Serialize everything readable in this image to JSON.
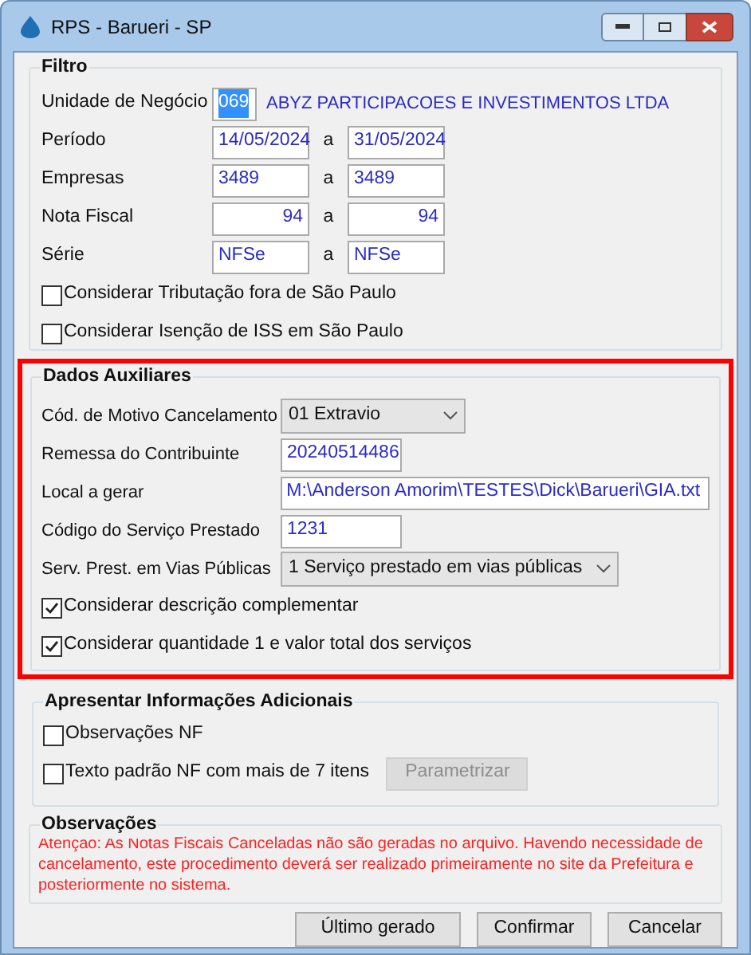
{
  "window": {
    "title": "RPS - Barueri - SP"
  },
  "filtro": {
    "title": "Filtro",
    "unidade": {
      "label": "Unidade de Negócio",
      "code": "069",
      "code_selected": true,
      "name": "ABYZ PARTICIPACOES E INVESTIMENTOS LTDA"
    },
    "ranges": [
      {
        "label": "Período",
        "from": "14/05/2024",
        "sep": "a",
        "to": "31/05/2024",
        "numeric": false
      },
      {
        "label": "Empresas",
        "from": "3489",
        "sep": "a",
        "to": "3489",
        "numeric": false
      },
      {
        "label": "Nota Fiscal",
        "from": "94",
        "sep": "a",
        "to": "94",
        "numeric": true
      },
      {
        "label": "Série",
        "from": "NFSe",
        "sep": "a",
        "to": "NFSe",
        "numeric": false
      }
    ],
    "checks": [
      {
        "label": "Considerar Tributação fora de São Paulo",
        "checked": false
      },
      {
        "label": "Considerar Isenção de ISS em São Paulo",
        "checked": false
      }
    ]
  },
  "dados": {
    "title": "Dados Auxiliares",
    "highlighted": true,
    "rows": [
      {
        "kind": "select",
        "label": "Cód. de Motivo Cancelamento",
        "value": "01 Extravio"
      },
      {
        "kind": "text",
        "label": "Remessa do Contribuinte",
        "value": "20240514486"
      },
      {
        "kind": "widetext",
        "label": "Local a gerar",
        "value": "M:\\Anderson Amorim\\TESTES\\Dick\\Barueri\\GIA.txt"
      },
      {
        "kind": "text",
        "label": "Código do Serviço Prestado",
        "value": "1231"
      },
      {
        "kind": "wideselect",
        "label": "Serv. Prest. em Vias Públicas",
        "value": "1 Serviço prestado em vias públicas"
      },
      {
        "kind": "check",
        "label": "Considerar descrição complementar",
        "checked": true
      },
      {
        "kind": "check",
        "label": "Considerar quantidade 1 e valor total dos serviços",
        "checked": true
      }
    ]
  },
  "adicionais": {
    "title": "Apresentar Informações Adicionais",
    "checks": [
      {
        "label": "Observações NF",
        "checked": false
      },
      {
        "label": "Texto padrão NF com mais de 7 itens",
        "checked": false
      }
    ],
    "button": {
      "label": "Parametrizar",
      "disabled": true
    }
  },
  "observacoes": {
    "title": "Observações",
    "text": "Atenção: As Notas Fiscais Canceladas não são geradas no arquivo. Havendo necessidade de cancelamento, este procedimento deverá ser realizado primeiramente no site da Prefeitura e posteriormente no sistema."
  },
  "buttons": [
    {
      "label": "Último gerado"
    },
    {
      "label": "Confirmar"
    },
    {
      "label": "Cancelar"
    }
  ]
}
